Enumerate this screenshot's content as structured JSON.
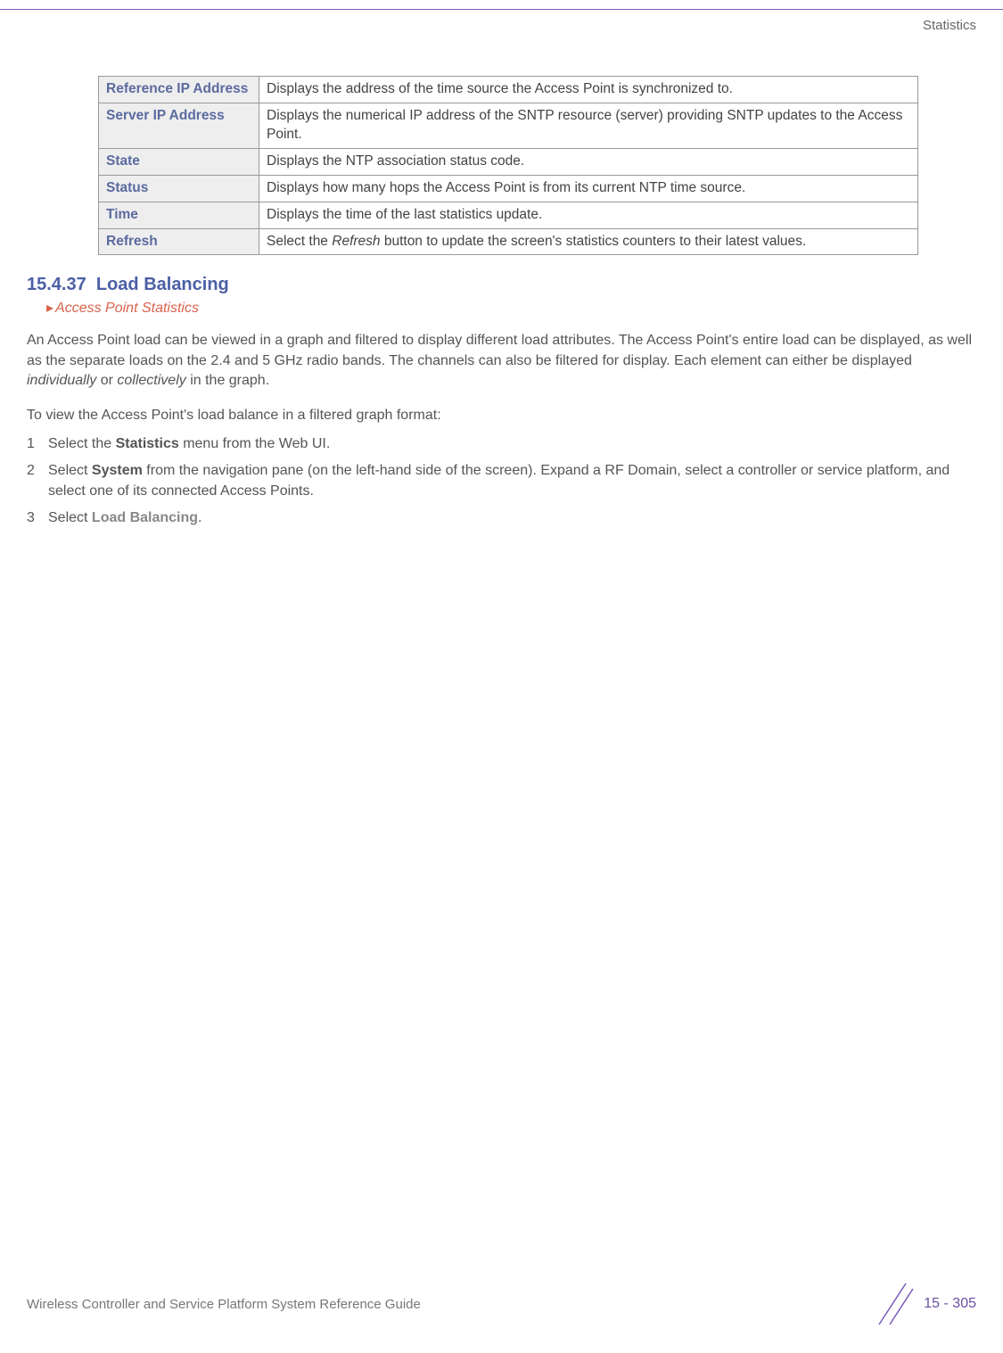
{
  "header": {
    "label": "Statistics"
  },
  "table": {
    "rows": [
      {
        "term": "Reference IP Address",
        "desc": "Displays the address of the time source the Access Point is synchronized to."
      },
      {
        "term": "Server IP Address",
        "desc": "Displays the numerical IP address of the SNTP resource (server) providing SNTP updates to the Access Point."
      },
      {
        "term": "State",
        "desc": "Displays the NTP association status code."
      },
      {
        "term": "Status",
        "desc": "Displays how many hops the Access Point is from its current NTP time source."
      },
      {
        "term": "Time",
        "desc": "Displays the time of the last statistics update."
      },
      {
        "term": "Refresh",
        "desc_pre": "Select the ",
        "desc_em": "Refresh",
        "desc_post": " button to update the screen's statistics counters to their latest values."
      }
    ]
  },
  "section": {
    "number": "15.4.37",
    "title": "Load Balancing",
    "breadcrumb": "Access Point Statistics"
  },
  "paragraphs": {
    "intro_pre": "An Access Point load can be viewed in a graph and filtered to display different load attributes. The Access Point's entire load can be displayed, as well as the separate loads on the 2.4 and 5 GHz radio bands. The channels can also be filtered for display. Each element can either be displayed ",
    "intro_em1": "individually",
    "intro_mid": " or ",
    "intro_em2": "collectively",
    "intro_post": " in the graph.",
    "lead": "To view the Access Point's load balance in a filtered graph format:"
  },
  "steps": [
    {
      "num": "1",
      "pre": "Select the ",
      "bold": "Statistics",
      "post": " menu from the Web UI."
    },
    {
      "num": "2",
      "pre": "Select ",
      "bold": "System",
      "post": " from the navigation pane (on the left-hand side of the screen). Expand a RF Domain, select a controller or service platform, and select one of its connected Access Points."
    },
    {
      "num": "3",
      "pre": "Select ",
      "bold_grey": "Load Balancing",
      "post": "."
    }
  ],
  "footer": {
    "doc_title": "Wireless Controller and Service Platform System Reference Guide",
    "page": "15 - 305"
  }
}
